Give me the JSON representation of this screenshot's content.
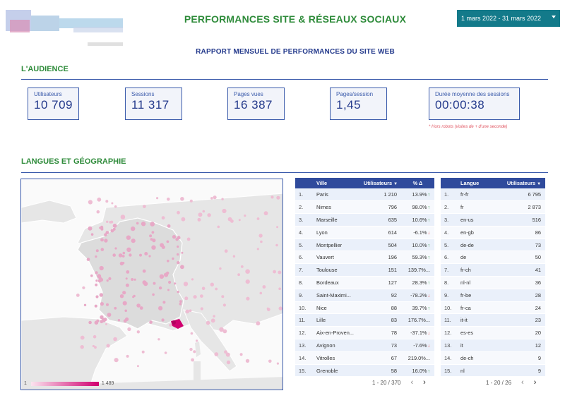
{
  "header": {
    "title": "PERFORMANCES SITE & RÉSEAUX SOCIAUX",
    "subtitle": "RAPPORT MENSUEL DE PERFORMANCES DU SITE WEB",
    "date_range": "1 mars 2022 - 31 mars 2022"
  },
  "audience": {
    "section_title": "L'AUDIENCE",
    "kpis": [
      {
        "label": "Utilisateurs",
        "value": "10 709"
      },
      {
        "label": "Sessions",
        "value": "11 317"
      },
      {
        "label": "Pages vues",
        "value": "16 387"
      },
      {
        "label": "Pages/session",
        "value": "1,45"
      },
      {
        "label": "Durée moyenne des sessions",
        "value": "00:00:38"
      }
    ],
    "note": "* Hors robots (visites de + d'une seconde)"
  },
  "geo": {
    "section_title": "LANGUES ET GÉOGRAPHIE",
    "legend_min": "1",
    "legend_max": "1 489",
    "colors": {
      "accent": "#d0006f",
      "header": "#2f4a9c",
      "green": "#2e8b3a"
    }
  },
  "city_table": {
    "headers": {
      "city": "Ville",
      "users": "Utilisateurs",
      "delta": "% Δ"
    },
    "rows": [
      {
        "idx": "1.",
        "city": "Paris",
        "users": "1 210",
        "delta": "13.9%",
        "trend": "up"
      },
      {
        "idx": "2.",
        "city": "Nimes",
        "users": "796",
        "delta": "98.0%",
        "trend": "up"
      },
      {
        "idx": "3.",
        "city": "Marseille",
        "users": "635",
        "delta": "10.6%",
        "trend": "up"
      },
      {
        "idx": "4.",
        "city": "Lyon",
        "users": "614",
        "delta": "-6.1%",
        "trend": "down"
      },
      {
        "idx": "5.",
        "city": "Montpellier",
        "users": "504",
        "delta": "10.0%",
        "trend": "up"
      },
      {
        "idx": "6.",
        "city": "Vauvert",
        "users": "196",
        "delta": "59.3%",
        "trend": "up"
      },
      {
        "idx": "7.",
        "city": "Toulouse",
        "users": "151",
        "delta": "139.7%...",
        "trend": ""
      },
      {
        "idx": "8.",
        "city": "Bordeaux",
        "users": "127",
        "delta": "28.3%",
        "trend": "up"
      },
      {
        "idx": "9.",
        "city": "Saint-Maximi...",
        "users": "92",
        "delta": "-78.2%",
        "trend": "down"
      },
      {
        "idx": "10.",
        "city": "Nice",
        "users": "88",
        "delta": "39.7%",
        "trend": "up"
      },
      {
        "idx": "11.",
        "city": "Lille",
        "users": "83",
        "delta": "176.7%...",
        "trend": ""
      },
      {
        "idx": "12.",
        "city": "Aix-en-Proven...",
        "users": "78",
        "delta": "-37.1%",
        "trend": "down"
      },
      {
        "idx": "13.",
        "city": "Avignon",
        "users": "73",
        "delta": "-7.6%",
        "trend": "down"
      },
      {
        "idx": "14.",
        "city": "Vitrolles",
        "users": "67",
        "delta": "219.0%...",
        "trend": ""
      },
      {
        "idx": "15.",
        "city": "Grenoble",
        "users": "58",
        "delta": "16.0%",
        "trend": "up"
      }
    ],
    "pagination": "1 - 20 / 370"
  },
  "lang_table": {
    "headers": {
      "lang": "Langue",
      "users": "Utilisateurs"
    },
    "rows": [
      {
        "idx": "1.",
        "lang": "fr-fr",
        "users": "6 795"
      },
      {
        "idx": "2.",
        "lang": "fr",
        "users": "2 873"
      },
      {
        "idx": "3.",
        "lang": "en-us",
        "users": "516"
      },
      {
        "idx": "4.",
        "lang": "en-gb",
        "users": "86"
      },
      {
        "idx": "5.",
        "lang": "de-de",
        "users": "73"
      },
      {
        "idx": "6.",
        "lang": "de",
        "users": "50"
      },
      {
        "idx": "7.",
        "lang": "fr-ch",
        "users": "41"
      },
      {
        "idx": "8.",
        "lang": "nl-nl",
        "users": "36"
      },
      {
        "idx": "9.",
        "lang": "fr-be",
        "users": "28"
      },
      {
        "idx": "10.",
        "lang": "fr-ca",
        "users": "24"
      },
      {
        "idx": "11.",
        "lang": "it-it",
        "users": "23"
      },
      {
        "idx": "12.",
        "lang": "es-es",
        "users": "20"
      },
      {
        "idx": "13.",
        "lang": "it",
        "users": "12"
      },
      {
        "idx": "14.",
        "lang": "de-ch",
        "users": "9"
      },
      {
        "idx": "15.",
        "lang": "nl",
        "users": "9"
      }
    ],
    "pagination": "1 - 20 / 26"
  },
  "icons": {
    "prev": "chevron-left-icon",
    "next": "chevron-right-icon",
    "sort": "sort-desc-icon",
    "dropdown": "caret-down-icon"
  }
}
